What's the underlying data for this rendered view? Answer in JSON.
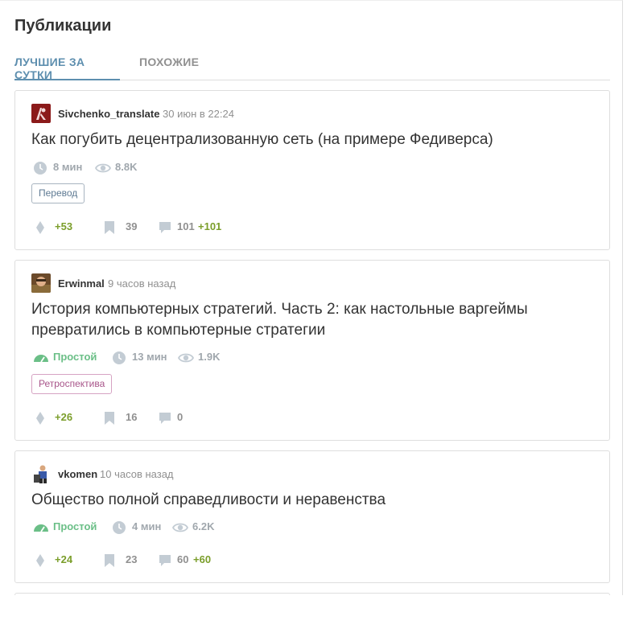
{
  "page": {
    "title": "Публикации"
  },
  "tabs": [
    {
      "label": "ЛУЧШИЕ ЗА СУТКИ",
      "active": true
    },
    {
      "label": "ПОХОЖИЕ",
      "active": false
    }
  ],
  "posts": [
    {
      "author": "Sivchenko_translate",
      "time": "30 июн в 22:24",
      "title": "Как погубить децентрализованную сеть (на примере Федиверса)",
      "complexity": "",
      "reading_time": "8 мин",
      "views": "8.8K",
      "tag": "Перевод",
      "votes": "+53",
      "bookmarks": "39",
      "comments": "101",
      "new_comments": "+101"
    },
    {
      "author": "Erwinmal",
      "time": "9 часов назад",
      "title": "История компьютерных стратегий. Часть 2: как настольные варгеймы превратились в компьютерные стратегии",
      "complexity": "Простой",
      "reading_time": "13 мин",
      "views": "1.9K",
      "tag": "Ретроспектива",
      "votes": "+26",
      "bookmarks": "16",
      "comments": "0",
      "new_comments": ""
    },
    {
      "author": "vkomen",
      "time": "10 часов назад",
      "title": "Общество полной справедливости и неравенства",
      "complexity": "Простой",
      "reading_time": "4 мин",
      "views": "6.2K",
      "tag": "",
      "votes": "+24",
      "bookmarks": "23",
      "comments": "60",
      "new_comments": "+60"
    }
  ],
  "colors": {
    "accent": "#5e8faf",
    "positive": "#7b9e2b",
    "complexity_easy": "#6bbf87",
    "muted": "#909090"
  }
}
